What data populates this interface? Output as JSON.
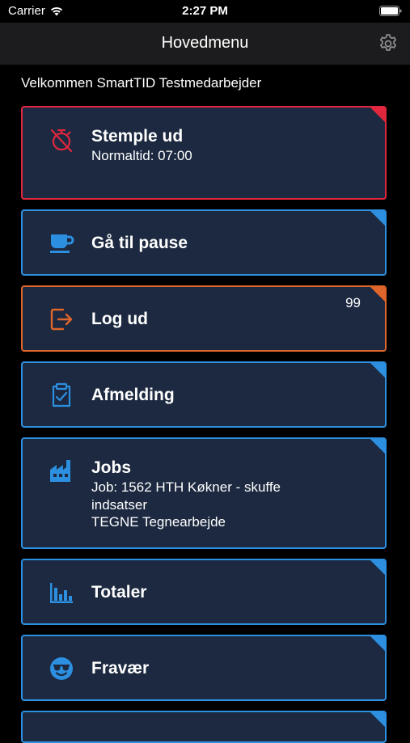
{
  "status_bar": {
    "carrier": "Carrier",
    "time": "2:27 PM"
  },
  "nav": {
    "title": "Hovedmenu",
    "settings_icon": "gear-icon"
  },
  "welcome": "Velkommen SmartTID Testmedarbejder",
  "colors": {
    "blue": "#2d8fe0",
    "red": "#e0273e",
    "orange": "#e0652a",
    "card_bg": "#1c2940"
  },
  "cards": [
    {
      "title": "Stemple ud",
      "sub": [
        "Normaltid: 07:00"
      ],
      "icon": "stopwatch-off-icon",
      "accent": "red"
    },
    {
      "title": "Gå til pause",
      "sub": [],
      "icon": "coffee-cup-icon",
      "accent": "blue"
    },
    {
      "title": "Log ud",
      "sub": [],
      "icon": "logout-icon",
      "accent": "orange",
      "badge": "99"
    },
    {
      "title": "Afmelding",
      "sub": [],
      "icon": "clipboard-check-icon",
      "accent": "blue"
    },
    {
      "title": "Jobs",
      "sub": [
        "Job: 1562 HTH Køkner - skuffe",
        "indsatser",
        "TEGNE Tegnearbejde"
      ],
      "icon": "factory-icon",
      "accent": "blue"
    },
    {
      "title": "Totaler",
      "sub": [],
      "icon": "bar-chart-icon",
      "accent": "blue"
    },
    {
      "title": "Fravær",
      "sub": [],
      "icon": "sunglasses-face-icon",
      "accent": "blue"
    }
  ]
}
